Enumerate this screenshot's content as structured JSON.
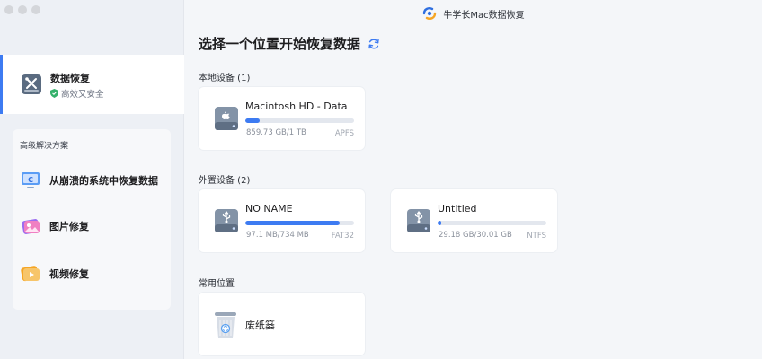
{
  "window": {
    "app_title": "牛学长Mac数据恢复"
  },
  "sidebar": {
    "main_item": {
      "title": "数据恢复",
      "subtitle": "高效又安全"
    },
    "advanced": {
      "title": "高级解决方案",
      "items": [
        {
          "label": "从崩溃的系统中恢复数据",
          "icon": "monitor-recovery-icon"
        },
        {
          "label": "图片修复",
          "icon": "photo-repair-icon"
        },
        {
          "label": "视频修复",
          "icon": "video-repair-icon"
        }
      ]
    }
  },
  "main": {
    "page_title": "选择一个位置开始恢复数据",
    "local_section": "本地设备 (1)",
    "external_section": "外置设备 (2)",
    "common_section": "常用位置",
    "local_devices": [
      {
        "name": "Macintosh HD - Data",
        "size": "859.73 GB/1 TB",
        "fs": "APFS",
        "used_fraction": 0.13,
        "icon": "apple-drive-icon"
      }
    ],
    "external_devices": [
      {
        "name": "NO NAME",
        "size": "97.1 MB/734 MB",
        "fs": "FAT32",
        "used_fraction": 0.87,
        "icon": "usb-drive-icon"
      },
      {
        "name": "Untitled",
        "size": "29.18 GB/30.01 GB",
        "fs": "NTFS",
        "used_fraction": 0.03,
        "icon": "usb-drive-icon"
      }
    ],
    "common_locations": [
      {
        "name": "废纸篓",
        "icon": "trash-icon"
      }
    ]
  },
  "colors": {
    "accent": "#3d7bf2",
    "bar_track": "#e3e7ee",
    "sidebar_bg": "#edf0f5"
  }
}
